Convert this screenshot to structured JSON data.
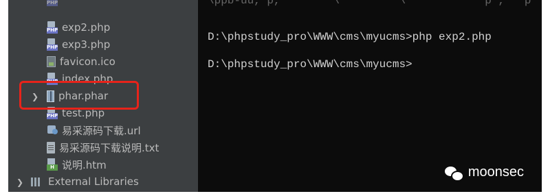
{
  "sidebar": {
    "files": [
      {
        "name": "exp2.php",
        "icon": "php-file-icon"
      },
      {
        "name": "exp3.php",
        "icon": "php-file-icon"
      },
      {
        "name": "favicon.ico",
        "icon": "ico-file-icon"
      },
      {
        "name": "index.php",
        "icon": "php-file-icon"
      },
      {
        "name": "phar.phar",
        "icon": "phar-archive-icon"
      },
      {
        "name": "test.php",
        "icon": "php-file-icon"
      },
      {
        "name": "易采源码下载.url",
        "icon": "url-file-icon"
      },
      {
        "name": "易采源码下载说明.txt",
        "icon": "text-file-icon"
      },
      {
        "name": "说明.htm",
        "icon": "html-file-icon"
      }
    ],
    "external_libraries": "External Libraries"
  },
  "terminal": {
    "lines": [
      "D:\\phpstudy_pro\\WWW\\cms\\myucms>php exp2.php",
      "D:\\phpstudy_pro\\WWW\\cms\\myucms>"
    ]
  },
  "watermark": {
    "text": "moonsec",
    "icon": "wechat-icon"
  },
  "colors": {
    "sidebar_bg": "#3c3f41",
    "terminal_bg": "#0c0c0c",
    "highlight_border": "#e8231a",
    "text": "#bbbbbb"
  }
}
